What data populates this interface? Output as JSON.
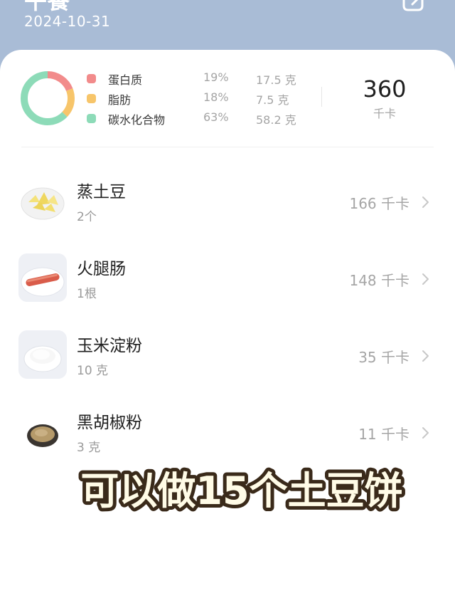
{
  "header": {
    "meal_title": "午餐",
    "date": "2024-10-31",
    "edit_icon": "edit-icon"
  },
  "nutrition": {
    "macros": [
      {
        "name": "蛋白质",
        "percent": "19%",
        "amount": "17.5 克",
        "color": "#f28b8b",
        "share": 0.19
      },
      {
        "name": "脂肪",
        "percent": "18%",
        "amount": "7.5 克",
        "color": "#f7c56a",
        "share": 0.18
      },
      {
        "name": "碳水化合物",
        "percent": "63%",
        "amount": "58.2 克",
        "color": "#8ddbb8",
        "share": 0.63
      }
    ],
    "total_kcal": "360",
    "kcal_unit": "千卡"
  },
  "foods": [
    {
      "name": "蒸土豆",
      "quantity": "2个",
      "kcal": "166 千卡",
      "thumb": "steamed-potato"
    },
    {
      "name": "火腿肠",
      "quantity": "1根",
      "kcal": "148 千卡",
      "thumb": "ham-sausage"
    },
    {
      "name": "玉米淀粉",
      "quantity": "10 克",
      "kcal": "35 千卡",
      "thumb": "corn-starch"
    },
    {
      "name": "黑胡椒粉",
      "quantity": "3 克",
      "kcal": "11 千卡",
      "thumb": "black-pepper-powder"
    }
  ],
  "overlay": {
    "caption": "可以做15个土豆饼"
  }
}
